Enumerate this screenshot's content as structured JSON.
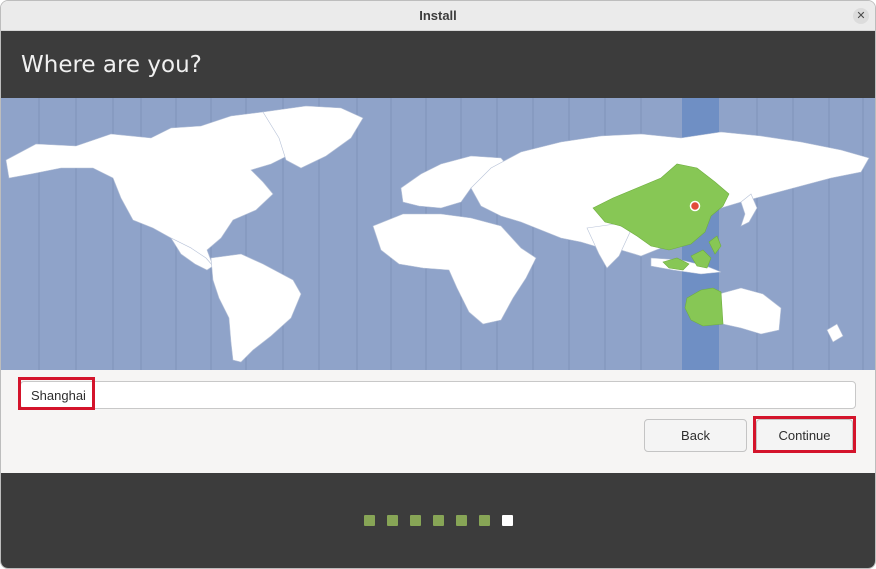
{
  "window": {
    "title": "Install",
    "close_glyph": "✕"
  },
  "header": {
    "heading": "Where are you?"
  },
  "map": {
    "ocean_color": "#8fa3c9",
    "land_color": "#ffffff",
    "selected_region_color": "#87c755",
    "selected_timezone_band_color": "#6f8fc4",
    "selected_city_marker_color": "#e24a3b"
  },
  "timezone": {
    "value": "Shanghai",
    "highlight_color": "#d4142b"
  },
  "buttons": {
    "back": "Back",
    "continue": "Continue"
  },
  "progress": {
    "total_steps": 7,
    "current_step": 7,
    "done_color": "#87a556",
    "current_color": "#ffffff"
  }
}
